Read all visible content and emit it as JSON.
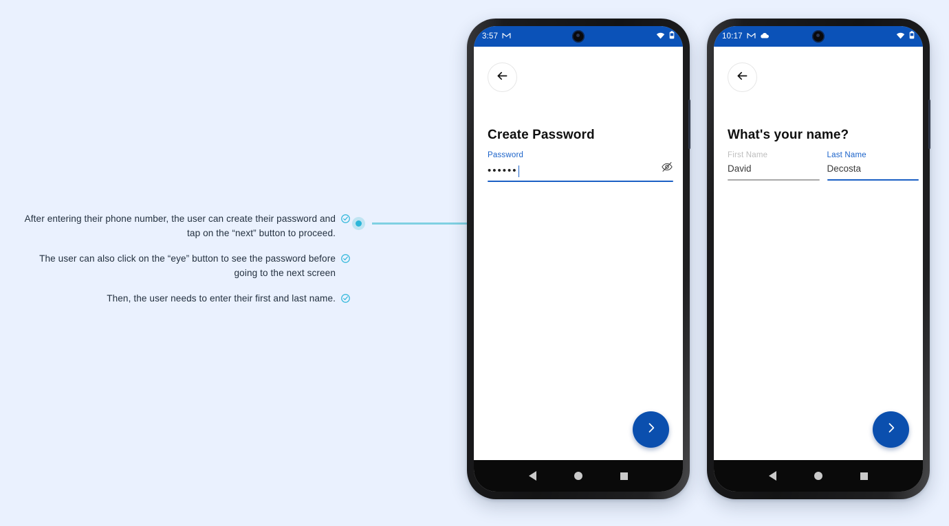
{
  "page": {
    "background_color": "#eaf1fe",
    "accent_color": "#1a5fc4",
    "annotation_accent": "#2cb6d9"
  },
  "annotations": {
    "items": [
      {
        "text": "After entering their phone number, the user can create their password and tap on the “next” button to proceed.",
        "icon": "check-circle-icon"
      },
      {
        "text": "The user can also click on the “eye” button to see the password before going to the next screen",
        "icon": "check-circle-icon"
      },
      {
        "text": "Then, the user needs to enter their first and last name.",
        "icon": "check-circle-icon"
      }
    ]
  },
  "phones": [
    {
      "id": "phone-create-password",
      "statusbar": {
        "time": "3:57",
        "left_icons": [
          "gmail-icon"
        ],
        "right_icons": [
          "wifi-icon",
          "battery-icon"
        ]
      },
      "back_button": {
        "icon": "back-arrow-icon",
        "label": "Back"
      },
      "title": "Create Password",
      "password_field": {
        "label": "Password",
        "value": "••••••",
        "placeholder": "Password",
        "toggle_icon": "eye-off-icon",
        "focused": true
      },
      "fab": {
        "icon": "chevron-right-icon",
        "label": "Next"
      },
      "navbar": {
        "back": "back-triangle-icon",
        "home": "home-circle-icon",
        "recents": "recents-square-icon"
      }
    },
    {
      "id": "phone-whats-your-name",
      "statusbar": {
        "time": "10:17",
        "left_icons": [
          "gmail-icon",
          "cloud-icon"
        ],
        "right_icons": [
          "wifi-icon",
          "battery-icon"
        ]
      },
      "back_button": {
        "icon": "back-arrow-icon",
        "label": "Back"
      },
      "title": "What's your name?",
      "name_fields": [
        {
          "label": "First Name",
          "value": "David",
          "focused": false
        },
        {
          "label": "Last Name",
          "value": "Decosta",
          "focused": true
        }
      ],
      "fab": {
        "icon": "chevron-right-icon",
        "label": "Next"
      },
      "navbar": {
        "back": "back-triangle-icon",
        "home": "home-circle-icon",
        "recents": "recents-square-icon"
      }
    }
  ]
}
